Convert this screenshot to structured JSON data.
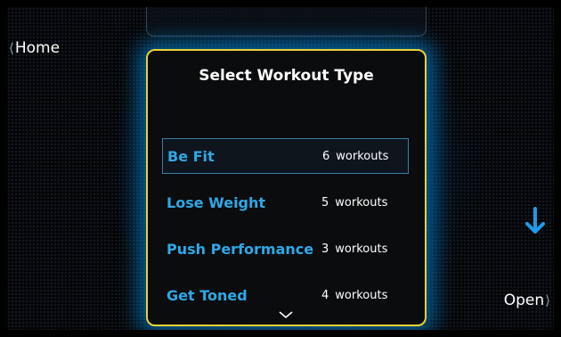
{
  "nav": {
    "home_label": "Home",
    "open_label": "Open"
  },
  "dialog": {
    "title": "Select Workout Type",
    "items": [
      {
        "name": "Be Fit",
        "count": "6",
        "unit": "workouts",
        "selected": true
      },
      {
        "name": "Lose Weight",
        "count": "5",
        "unit": "workouts",
        "selected": false
      },
      {
        "name": "Push Performance",
        "count": "3",
        "unit": "workouts",
        "selected": false
      },
      {
        "name": "Get Toned",
        "count": "4",
        "unit": "workouts",
        "selected": false
      }
    ]
  },
  "icons": {
    "back": "chevron-left-icon",
    "forward": "chevron-right-icon",
    "scroll_down": "chevron-down-icon",
    "move_down": "arrow-down-icon"
  },
  "colors": {
    "dialog_border": "#e9d233",
    "accent_blue": "#2ea8e6",
    "glow": "#0096f0",
    "selected_border": "#3d7fa6"
  }
}
